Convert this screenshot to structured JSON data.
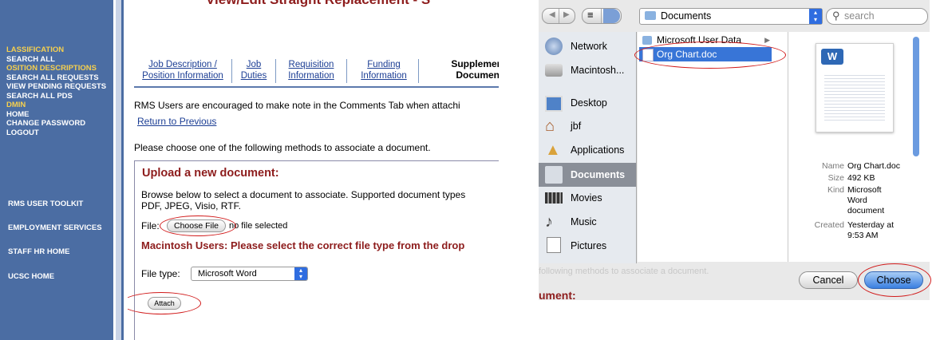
{
  "rms": {
    "page_title": "View/Edit Straight Replacement - S",
    "sidebar": {
      "classification_heading": "LASSIFICATION",
      "classification_links": [
        "SEARCH ALL"
      ],
      "position_heading": "OSITION DESCRIPTIONS",
      "position_links": [
        "SEARCH ALL REQUESTS",
        "VIEW PENDING REQUESTS",
        "SEARCH ALL PDS"
      ],
      "admin_heading": "DMIN",
      "admin_links": [
        "HOME",
        "CHANGE PASSWORD",
        "LOGOUT"
      ],
      "toolkit_links": [
        "RMS USER TOOLKIT",
        "EMPLOYMENT SERVICES",
        "STAFF HR HOME",
        "UCSC HOME"
      ]
    },
    "tabs": [
      {
        "line1": "Job Description /",
        "line2": "Position Information"
      },
      {
        "line1": "Job",
        "line2": "Duties"
      },
      {
        "line1": "Requisition",
        "line2": "Information"
      },
      {
        "line1": "Funding",
        "line2": "Information"
      }
    ],
    "active_tab": {
      "line1": "Supplemen",
      "line2": "Document"
    },
    "notice": "RMS Users are encouraged to make note in the Comments Tab when attachi",
    "return_link": "Return to Previous",
    "methods_text": "Please choose one of the following methods to associate a document.",
    "upload": {
      "heading": "Upload a new document:",
      "browse_line1": "Browse below to select a document to associate. Supported document types",
      "browse_line2": "PDF, JPEG, Visio, RTF.",
      "file_label": "File:",
      "choose_file_label": "Choose File",
      "no_file_text": "no file selected",
      "mac_warning": "Macintosh Users: Please select the correct file type from the drop",
      "file_type_label": "File type:",
      "file_type_value": "Microsoft Word",
      "attach_label": "Attach"
    }
  },
  "dialog": {
    "location": "Documents",
    "search_placeholder": "search",
    "sidebar_items": [
      {
        "label": "Network",
        "icon": "network-icon"
      },
      {
        "label": "Macintosh...",
        "icon": "hard-drive-icon"
      },
      {
        "label": "Desktop",
        "icon": "desktop-icon"
      },
      {
        "label": "jbf",
        "icon": "home-icon"
      },
      {
        "label": "Applications",
        "icon": "applications-icon"
      },
      {
        "label": "Documents",
        "icon": "documents-folder-icon",
        "selected": true
      },
      {
        "label": "Movies",
        "icon": "movies-icon"
      },
      {
        "label": "Music",
        "icon": "music-icon"
      },
      {
        "label": "Pictures",
        "icon": "pictures-icon"
      }
    ],
    "files": [
      {
        "name": "Microsoft User Data",
        "kind": "folder"
      },
      {
        "name": "Org Chart.doc",
        "kind": "document",
        "selected": true
      }
    ],
    "preview": {
      "name_key": "Name",
      "name_val": "Org Chart.doc",
      "size_key": "Size",
      "size_val": "492 KB",
      "kind_key": "Kind",
      "kind_val": "Microsoft Word document",
      "created_key": "Created",
      "created_val": "Yesterday at 9:53 AM"
    },
    "behind_text": "following methods to associate a document.",
    "behind_heading": "ument:",
    "cancel_label": "Cancel",
    "choose_label": "Choose"
  },
  "colors": {
    "sidebar_blue": "#4b6da3",
    "heading_yellow": "#f6d04e",
    "heading_maroon": "#8d1c1c",
    "link_blue": "#1c3e94",
    "annotation_red": "#d11a1a",
    "aqua_blue": "#3a7fe0"
  }
}
